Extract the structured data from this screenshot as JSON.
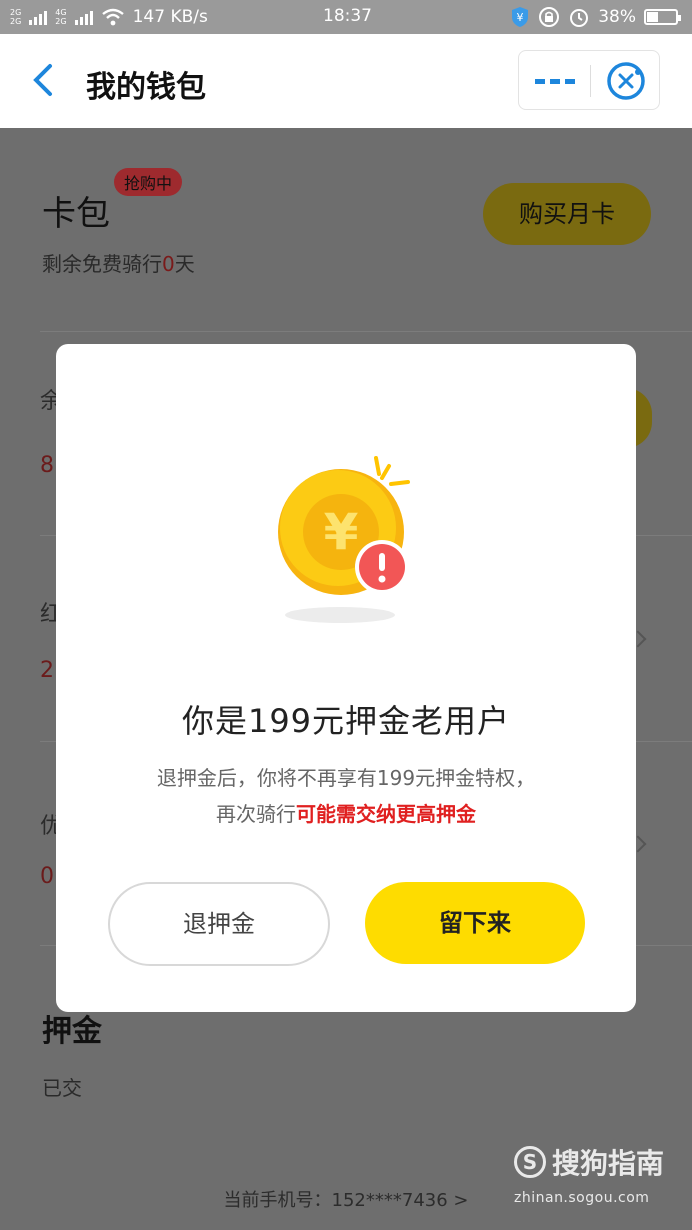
{
  "status_bar": {
    "network_top": "2G",
    "network_bottom": "2G",
    "network2_top": "4G",
    "network2_bottom": "2G",
    "speed": "147 KB/s",
    "time": "18:37",
    "battery_text": "38%",
    "battery_level": 0.38
  },
  "nav": {
    "title": "我的钱包",
    "accent_color": "#1d86dc"
  },
  "background": {
    "card": {
      "title": "卡包",
      "tag": "抢购中",
      "sub_prefix": "剩余免费骑行",
      "sub_days": "0",
      "sub_suffix": "天",
      "buy_button": "购买月卡"
    },
    "peeks": [
      {
        "label": "余",
        "value": "8"
      },
      {
        "label": "红",
        "value": "2"
      },
      {
        "label": "优",
        "value": "0"
      }
    ],
    "deposit": {
      "title": "押金",
      "status": "已交"
    },
    "footer_phone": "当前手机号：152****7436 >"
  },
  "modal": {
    "title": "你是199元押金老用户",
    "desc_line1": "退押金后，你将不再享有199元押金特权，",
    "desc_line2_prefix": "再次骑行",
    "desc_line2_warn": "可能需交纳更高押金",
    "refund_button": "退押金",
    "stay_button": "留下来",
    "stay_color": "#fedc00",
    "warn_color": "#e02020"
  },
  "watermark": {
    "brand": "搜狗指南",
    "url": "zhinan.sogou.com"
  }
}
